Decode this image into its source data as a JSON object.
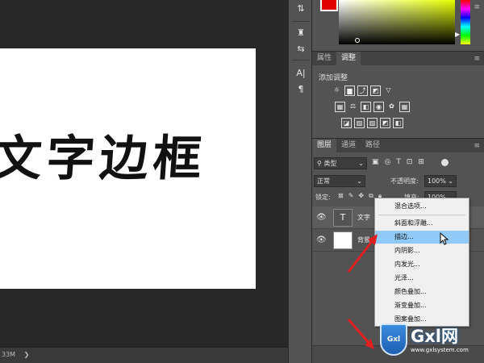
{
  "canvas": {
    "document_text": "文字边框",
    "status_text": "33M",
    "status_arrow": "❯"
  },
  "colors": {
    "foreground": "#e00000",
    "highlight": "#91c9f7"
  },
  "tools": [
    "⇅",
    "♜",
    "⇆",
    "A|",
    "¶"
  ],
  "props_panel": {
    "tabs": [
      "属性",
      "调整"
    ],
    "active_tab": "调整",
    "title": "添加调整"
  },
  "layers_panel": {
    "tabs": [
      "图层",
      "通道",
      "路径"
    ],
    "filter_kind": "类型",
    "blend_mode": "正常",
    "opacity_label": "不透明度:",
    "opacity_value": "100%",
    "lock_label": "锁定:",
    "fill_label": "填充:",
    "fill_value": "100%",
    "layers": [
      {
        "name": "文字",
        "thumb": "T"
      },
      {
        "name": "背景",
        "thumb": ""
      }
    ]
  },
  "context_menu": {
    "items": [
      "混合选项...",
      "斜面和浮雕...",
      "描边...",
      "内阴影...",
      "内发光...",
      "光泽...",
      "颜色叠加...",
      "渐变叠加...",
      "图案叠加..."
    ],
    "highlighted": "描边..."
  },
  "watermark": {
    "brand": "Gxl网",
    "url": "www.gxlsystem.com",
    "badge": "Gxl"
  }
}
